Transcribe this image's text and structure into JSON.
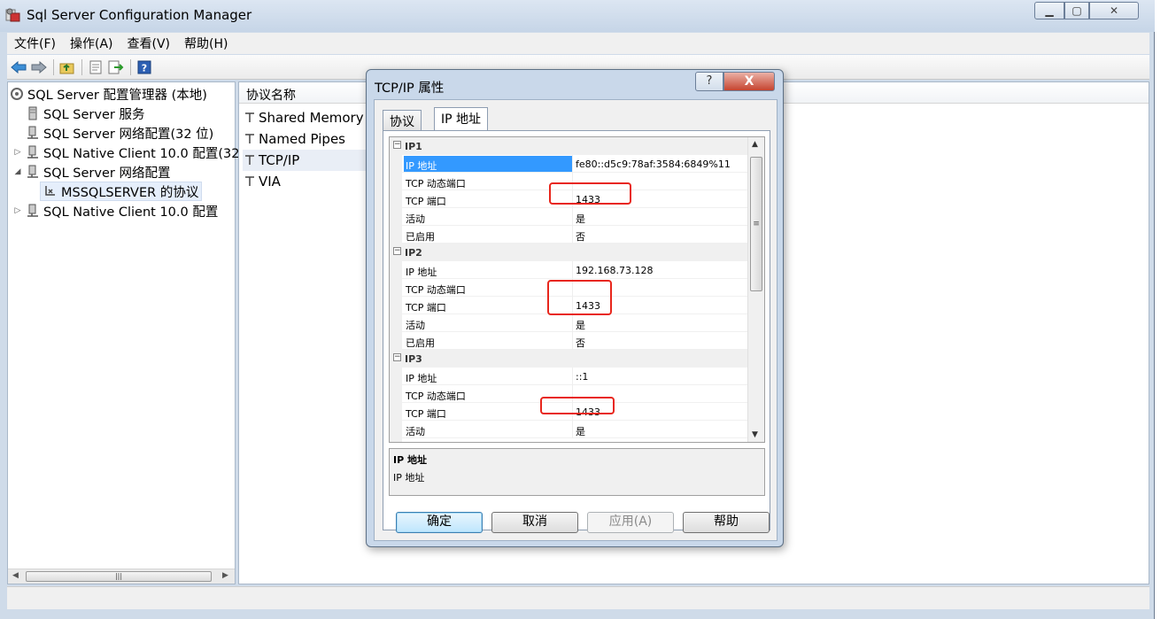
{
  "window": {
    "title": "Sql Server Configuration Manager"
  },
  "menu": [
    "文件(F)",
    "操作(A)",
    "查看(V)",
    "帮助(H)"
  ],
  "toolbar_icons": [
    "back-arrow-icon",
    "forward-arrow-icon",
    "up-folder-icon",
    "properties-icon",
    "export-icon",
    "help-icon"
  ],
  "tree": {
    "root": "SQL Server 配置管理器 (本地)",
    "items": [
      "SQL Server 服务",
      "SQL Server 网络配置(32 位)",
      "SQL Native Client 10.0 配置(32",
      "SQL Server 网络配置",
      "MSSQLSERVER 的协议",
      "SQL Native Client 10.0 配置"
    ]
  },
  "list": {
    "header": "协议名称",
    "rows": [
      "Shared Memory",
      "Named Pipes",
      "TCP/IP",
      "VIA"
    ]
  },
  "dialog": {
    "title": "TCP/IP 属性",
    "help_label": "?",
    "close_label": "X",
    "tabs": [
      "协议",
      "IP 地址"
    ],
    "groups": [
      {
        "name": "IP1",
        "props": [
          {
            "name": "IP 地址",
            "value": "fe80::d5c9:78af:3584:6849%11"
          },
          {
            "name": "TCP 动态端口",
            "value": ""
          },
          {
            "name": "TCP 端口",
            "value": "1433"
          },
          {
            "name": "活动",
            "value": "是"
          },
          {
            "name": "已启用",
            "value": "否"
          }
        ]
      },
      {
        "name": "IP2",
        "props": [
          {
            "name": "IP 地址",
            "value": "192.168.73.128"
          },
          {
            "name": "TCP 动态端口",
            "value": ""
          },
          {
            "name": "TCP 端口",
            "value": "1433"
          },
          {
            "name": "活动",
            "value": "是"
          },
          {
            "name": "已启用",
            "value": "否"
          }
        ]
      },
      {
        "name": "IP3",
        "props": [
          {
            "name": "IP 地址",
            "value": "::1"
          },
          {
            "name": "TCP 动态端口",
            "value": ""
          },
          {
            "name": "TCP 端口",
            "value": "1433"
          },
          {
            "name": "活动",
            "value": "是"
          }
        ]
      }
    ],
    "description": {
      "title": "IP 地址",
      "text": "IP 地址"
    },
    "buttons": {
      "ok": "确定",
      "cancel": "取消",
      "apply": "应用(A)",
      "help": "帮助"
    },
    "highlight_color": "#e8261c",
    "selection_color": "#3399ff"
  }
}
